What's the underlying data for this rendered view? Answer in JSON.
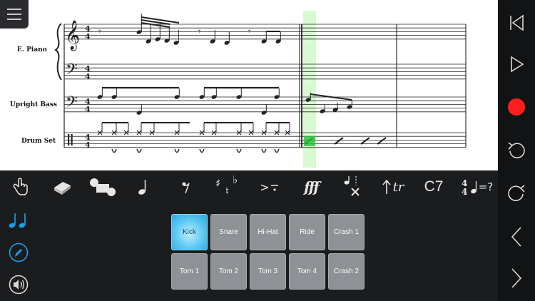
{
  "score": {
    "instruments": [
      "E. Piano",
      "Upright Bass",
      "Drum Set"
    ],
    "time_signature": {
      "top": "4",
      "bottom": "4"
    },
    "playhead_color": "#a9f39a"
  },
  "colors": {
    "accent": "#1aa0e8",
    "record": "#ff1f1f",
    "pad_active": "#3cb8ee",
    "pad": "#8e9297"
  },
  "sidebar": {
    "buttons": [
      "rewind-to-start-icon",
      "play-icon",
      "record-icon",
      "undo-icon",
      "redo-icon",
      "previous-icon",
      "next-icon"
    ]
  },
  "toolbar": {
    "accidentals": {
      "sharp": "♯",
      "natural": "♮",
      "flat": "♭"
    },
    "articulation": ">",
    "dynamic": "fff",
    "ornament": "tr",
    "chord": "C7",
    "tempo_question": "=?"
  },
  "drum_pads": {
    "selected": "Kick",
    "row1": [
      "Kick",
      "Snare",
      "Hi-Hat",
      "Ride",
      "Crash 1"
    ],
    "row2": [
      "Tom 1",
      "Tom 2",
      "Tom 3",
      "Tom 4",
      "Crash 2"
    ]
  }
}
